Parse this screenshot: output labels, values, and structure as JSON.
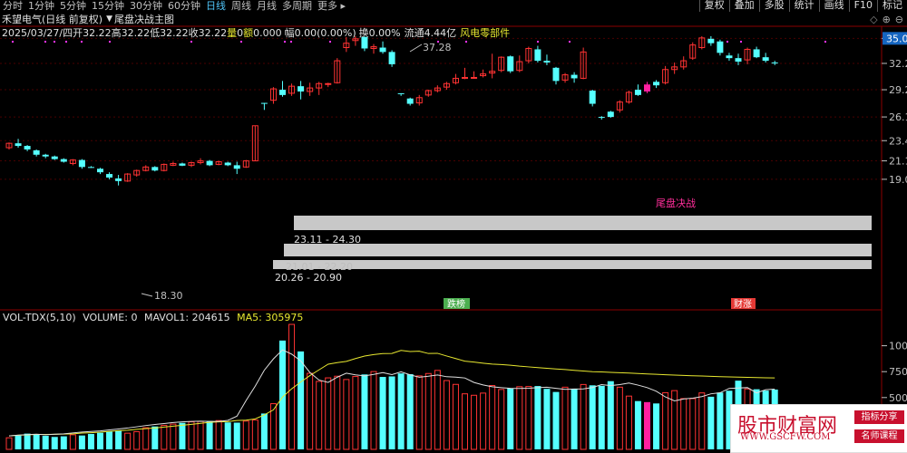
{
  "periods": [
    "分时",
    "1分钟",
    "5分钟",
    "15分钟",
    "30分钟",
    "60分钟",
    "日线",
    "周线",
    "月线",
    "多周期",
    "更多 ▸"
  ],
  "active_period": "日线",
  "right_tools": [
    "复权",
    "叠加",
    "多股",
    "统计",
    "画线",
    "F10",
    "标记"
  ],
  "title": "禾望电气(日线 前复权)",
  "indicator": "尾盘决战主图",
  "quote": {
    "date": "2025/03/27/四",
    "open_label": "开",
    "open": "32.22",
    "high_label": "高",
    "high": "32.22",
    "low_label": "低",
    "low": "32.22",
    "close_label": "收",
    "close": "32.22",
    "vol_label": "量",
    "vol": "0",
    "amt_label": "额",
    "amt": "0.000",
    "chg_label": "幅",
    "chg": "0.00(0.00%)",
    "turn_label": "换",
    "turn": "0.00%",
    "float_label": "流通",
    "float": "4.44亿",
    "sector": "风电零部件"
  },
  "current_price": "35.05",
  "annotations": {
    "high": "37.28",
    "low": "18.30",
    "signal": "尾盘决战",
    "bottom1": "跌榜",
    "bottom2": "财涨"
  },
  "zones": [
    "23.11 - 24.30",
    "21.01 - 22.20",
    "20.26 - 20.90"
  ],
  "volume_panel": {
    "title": "VOL-TDX(5,10)",
    "volume_label": "VOLUME:",
    "volume": "0",
    "mavol1_label": "MAVOL1:",
    "mavol1": "204615",
    "ma5_label": "MA5:",
    "ma5": "305975"
  },
  "watermark": {
    "site": "股市财富网",
    "url": "WWW.GSCFW.COM",
    "badge1": "指标分享",
    "badge2": "名师课程"
  },
  "colors": {
    "up": "#ff3333",
    "down": "#55ffff",
    "signal": "#ff1fa0",
    "zone": "#c8c8c8"
  },
  "chart_data": {
    "type": "candlestick",
    "y_ticks": [
      35.05,
      32.2,
      29.2,
      26.1,
      23.4,
      21.1,
      19.0
    ],
    "ylim": [
      18.2,
      36.4
    ],
    "volume_ticks": [
      1000,
      750,
      500
    ],
    "volume_ylim": [
      0,
      1250
    ],
    "candles": [
      [
        22.6,
        23.2,
        22.4,
        23.1
      ],
      [
        23.1,
        23.6,
        22.6,
        22.8
      ],
      [
        22.8,
        22.9,
        22.2,
        22.4
      ],
      [
        22.3,
        22.4,
        21.6,
        21.8
      ],
      [
        21.8,
        21.9,
        21.4,
        21.6
      ],
      [
        21.6,
        21.7,
        21.2,
        21.3
      ],
      [
        21.3,
        21.4,
        20.9,
        21.0
      ],
      [
        20.8,
        21.3,
        20.6,
        21.2
      ],
      [
        21.2,
        21.3,
        20.2,
        20.4
      ],
      [
        20.4,
        20.5,
        20.3,
        20.35
      ],
      [
        20.2,
        20.3,
        19.6,
        19.8
      ],
      [
        19.6,
        19.8,
        19.0,
        19.2
      ],
      [
        19.1,
        19.5,
        18.3,
        18.8
      ],
      [
        18.8,
        19.7,
        18.7,
        19.6
      ],
      [
        19.5,
        20.1,
        19.3,
        20.0
      ],
      [
        20.0,
        20.6,
        19.9,
        20.4
      ],
      [
        20.4,
        20.5,
        19.9,
        20.0
      ],
      [
        20.0,
        20.8,
        19.9,
        20.7
      ],
      [
        20.6,
        21.0,
        20.5,
        20.8
      ],
      [
        20.8,
        20.9,
        20.5,
        20.55
      ],
      [
        20.6,
        21.0,
        20.4,
        20.9
      ],
      [
        20.9,
        21.4,
        20.7,
        21.1
      ],
      [
        21.1,
        21.2,
        20.5,
        20.6
      ],
      [
        20.7,
        21.1,
        20.6,
        21.0
      ],
      [
        20.9,
        21.0,
        20.5,
        20.6
      ],
      [
        20.6,
        21.0,
        19.6,
        20.2
      ],
      [
        20.4,
        21.2,
        20.3,
        21.1
      ],
      [
        21.1,
        25.1,
        21.1,
        25.1
      ],
      [
        27.7,
        27.7,
        26.9,
        27.6
      ],
      [
        28.0,
        29.5,
        27.6,
        29.3
      ],
      [
        29.2,
        30.2,
        28.4,
        28.6
      ],
      [
        28.8,
        29.9,
        28.5,
        29.6
      ],
      [
        29.6,
        30.2,
        28.1,
        29.0
      ],
      [
        29.0,
        30.0,
        28.5,
        29.4
      ],
      [
        29.4,
        30.1,
        28.6,
        29.9
      ],
      [
        29.8,
        30.0,
        29.5,
        29.9
      ],
      [
        30.0,
        32.8,
        29.9,
        32.5
      ],
      [
        34.0,
        35.2,
        33.5,
        34.5
      ],
      [
        34.8,
        35.3,
        34.2,
        35.0
      ],
      [
        35.2,
        35.3,
        33.6,
        33.9
      ],
      [
        33.9,
        34.4,
        33.3,
        34.1
      ],
      [
        34.0,
        34.7,
        33.3,
        33.5
      ],
      [
        33.5,
        33.7,
        31.8,
        32.1
      ],
      [
        28.8,
        28.8,
        28.5,
        28.7
      ],
      [
        28.2,
        28.3,
        27.4,
        27.6
      ],
      [
        27.7,
        28.6,
        27.4,
        28.3
      ],
      [
        28.6,
        29.2,
        28.4,
        29.1
      ],
      [
        29.1,
        29.7,
        28.9,
        29.4
      ],
      [
        29.5,
        30.1,
        29.2,
        29.9
      ],
      [
        30.0,
        31.0,
        29.8,
        30.5
      ],
      [
        30.6,
        31.7,
        30.4,
        30.6
      ],
      [
        30.6,
        31.3,
        30.5,
        30.6
      ],
      [
        30.8,
        31.5,
        30.6,
        31.0
      ],
      [
        31.1,
        33.3,
        30.5,
        31.3
      ],
      [
        31.4,
        33.0,
        31.2,
        32.9
      ],
      [
        33.0,
        33.1,
        31.1,
        31.3
      ],
      [
        31.4,
        33.1,
        31.2,
        32.4
      ],
      [
        32.5,
        34.1,
        32.2,
        33.9
      ],
      [
        33.8,
        34.2,
        32.3,
        32.5
      ],
      [
        32.5,
        33.2,
        32.0,
        32.3
      ],
      [
        31.7,
        31.8,
        29.8,
        30.2
      ],
      [
        30.3,
        31.1,
        30.0,
        30.9
      ],
      [
        30.9,
        31.2,
        30.0,
        30.5
      ],
      [
        30.5,
        34.0,
        30.4,
        33.5
      ],
      [
        29.1,
        29.2,
        27.3,
        27.6
      ],
      [
        26.1,
        26.2,
        25.8,
        26.0
      ],
      [
        26.7,
        26.8,
        26.0,
        26.1
      ],
      [
        26.9,
        28.0,
        26.6,
        27.8
      ],
      [
        27.8,
        29.1,
        27.6,
        28.9
      ],
      [
        29.2,
        29.8,
        28.5,
        28.6
      ],
      [
        29.0,
        30.1,
        28.8,
        29.8
      ],
      [
        30.1,
        30.3,
        29.4,
        29.7
      ],
      [
        30.0,
        31.9,
        29.8,
        31.5
      ],
      [
        31.5,
        32.3,
        31.0,
        31.8
      ],
      [
        31.8,
        33.0,
        31.5,
        32.5
      ],
      [
        32.8,
        34.6,
        32.6,
        34.3
      ],
      [
        34.0,
        35.3,
        33.8,
        35.1
      ],
      [
        35.0,
        35.3,
        34.2,
        34.5
      ],
      [
        34.7,
        34.9,
        33.1,
        33.4
      ],
      [
        33.1,
        33.4,
        32.5,
        32.8
      ],
      [
        32.8,
        33.3,
        32.0,
        32.4
      ],
      [
        32.6,
        34.0,
        32.1,
        33.8
      ],
      [
        33.8,
        34.1,
        32.8,
        32.9
      ],
      [
        32.9,
        33.4,
        32.3,
        32.5
      ],
      [
        32.3,
        32.5,
        32.0,
        32.25
      ]
    ],
    "volume": [
      112,
      134,
      152,
      141,
      131,
      120,
      126,
      141,
      134,
      149,
      160,
      171,
      182,
      156,
      171,
      209,
      221,
      232,
      244,
      256,
      266,
      270,
      274,
      278,
      260,
      258,
      273,
      283,
      346,
      441,
      1050,
      1206,
      945,
      734,
      656,
      690,
      706,
      674,
      703,
      723,
      751,
      699,
      704,
      733,
      726,
      709,
      732,
      762,
      664,
      627,
      536,
      522,
      543,
      616,
      578,
      590,
      605,
      607,
      611,
      584,
      554,
      600,
      586,
      626,
      618,
      613,
      658,
      600,
      514,
      466,
      456,
      443,
      547,
      567,
      490,
      490,
      545,
      508,
      548,
      566,
      663,
      583,
      580,
      567,
      577
    ],
    "ma5": [
      130,
      138,
      142,
      146,
      141,
      146,
      150,
      159,
      167,
      173,
      178,
      188,
      197,
      206,
      218,
      230,
      240,
      249,
      259,
      265,
      270,
      272,
      270,
      270,
      280,
      320,
      471,
      610,
      764,
      873,
      960,
      919,
      854,
      742,
      669,
      646,
      696,
      735,
      719,
      709,
      723,
      741,
      721,
      748,
      719,
      696,
      706,
      718,
      701,
      697,
      689,
      646,
      622,
      604,
      596,
      589,
      588,
      590,
      596,
      600,
      589,
      579,
      582,
      584,
      597,
      625,
      615,
      625,
      640,
      620,
      596,
      561,
      506,
      468,
      486,
      494,
      509,
      536,
      546,
      588,
      592,
      596,
      545,
      576,
      581
    ],
    "mavol1": [
      130,
      137,
      140,
      144,
      144,
      145,
      147,
      150,
      157,
      161,
      166,
      174,
      180,
      185,
      193,
      200,
      206,
      215,
      224,
      233,
      242,
      251,
      261,
      265,
      268,
      279,
      282,
      294,
      333,
      381,
      505,
      584,
      650,
      712,
      767,
      822,
      837,
      849,
      876,
      900,
      915,
      924,
      926,
      955,
      944,
      947,
      925,
      927,
      901,
      876,
      851,
      842,
      832,
      823,
      818,
      812,
      803,
      796,
      789,
      782,
      776,
      770,
      763,
      756,
      750,
      747,
      743,
      740,
      736,
      732,
      728,
      724,
      720,
      717,
      713,
      710,
      708,
      705,
      702,
      699,
      697,
      695,
      693,
      691,
      690
    ]
  }
}
